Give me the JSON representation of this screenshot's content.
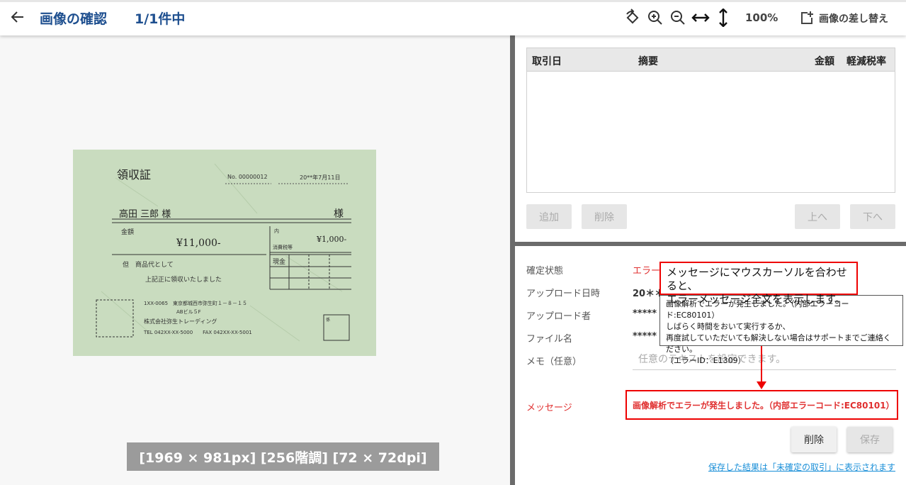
{
  "header": {
    "title": "画像の確認",
    "count": "1/1件中",
    "zoom": "100%",
    "replace_label": "画像の差し替え"
  },
  "receipt": {
    "heading": "領収証",
    "number": "No. 00000012",
    "date": "20**年7月11日",
    "recipient": "高田 三郎 様",
    "sama": "様",
    "amount_label": "金額",
    "amount": "¥11,000-",
    "inner_label": "内",
    "inner_amount": "¥1,000-",
    "tax_label": "消費税等",
    "cash_label": "現金",
    "proviso": "但　商品代として",
    "received": "上記正に領収いたしました",
    "address1": "1XX-0065　東京都城西市弥生町１－８－１５",
    "address2": "ABビル５F",
    "company": "株式会社弥生トレーディング",
    "phone": "TEL 042XX-XX-5000　　FAX 042XX-XX-5001",
    "stamp_label": "係"
  },
  "image_info": "[1969 × 981px] [256階調] [72 × 72dpi]",
  "transactions": {
    "columns": {
      "date": "取引日",
      "summary": "摘要",
      "amount": "金額",
      "tax": "軽減税率"
    },
    "buttons": {
      "add": "追加",
      "delete": "削除",
      "up": "上へ",
      "down": "下へ"
    }
  },
  "details": {
    "status_label": "確定状態",
    "status_value": "エラー",
    "upload_date_label": "アップロード日時",
    "upload_date_value": "20＊＊/",
    "uploader_label": "アップロード者",
    "uploader_value": "*****",
    "filename_label": "ファイル名",
    "filename_value": "*****",
    "memo_label": "メモ（任意）",
    "memo_placeholder": "任意のテキストを設定できます。",
    "message_label": "メッセージ",
    "message_value": "画像解析でエラーが発生しました。（内部エラーコード:EC80101）"
  },
  "callout": {
    "line1": "メッセージにマウスカーソルを合わせると、",
    "line2": "エラーメッセージ全文を表示します。"
  },
  "tooltip": {
    "line1": "画像解析でエラーが発生しました。（内部エラーコード:EC80101）",
    "line2": "しばらく時間をおいて実行するか、",
    "line3": "再度試していただいても解決しない場合はサポートまでご連絡ください。",
    "line4": "（エラーID：E1309）"
  },
  "actions": {
    "delete": "削除",
    "save": "保存",
    "note": "保存した結果は「未確定の取引」に表示されます"
  },
  "colors": {
    "accent": "#1e4f8f",
    "error": "#e03030",
    "link": "#1a8fd8"
  }
}
